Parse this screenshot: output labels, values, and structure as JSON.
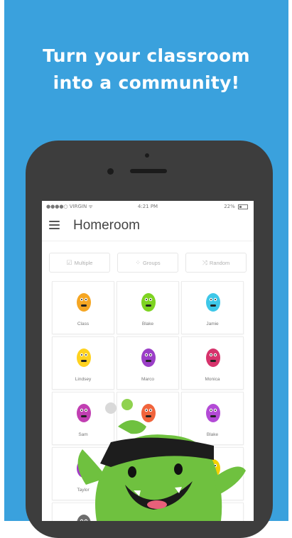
{
  "promo": {
    "headline_line1": "Turn your classroom",
    "headline_line2": "into a community!",
    "background_color": "#3aa1dd"
  },
  "statusbar": {
    "carrier": "●●●●○ VIRGIN ᯤ",
    "time": "4:21 PM",
    "battery": "22%"
  },
  "app": {
    "title": "Homeroom",
    "menu_icon": "hamburger-menu-icon"
  },
  "toolbar": {
    "multiple_label": "Multiple",
    "multiple_icon": "multi-select-icon",
    "groups_label": "Groups",
    "groups_icon": "groups-icon",
    "random_label": "Random",
    "random_icon": "shuffle-icon"
  },
  "students": [
    {
      "name": "Class",
      "color": "#f5a623"
    },
    {
      "name": "Blake",
      "color": "#7ed321"
    },
    {
      "name": "Jamie",
      "color": "#3ec7e8"
    },
    {
      "name": "Lindsey",
      "color": "#ffd21f"
    },
    {
      "name": "Marco",
      "color": "#9b3fc7"
    },
    {
      "name": "Monica",
      "color": "#d6336c"
    },
    {
      "name": "Sam",
      "color": "#c13fb2"
    },
    {
      "name": "",
      "color": "#f0643c"
    },
    {
      "name": "Blake",
      "color": "#b34bd6"
    },
    {
      "name": "Taylor",
      "color": "#a23bc6"
    },
    {
      "name": "",
      "color": "#ffffff"
    },
    {
      "name": "",
      "color": "#f5d000"
    },
    {
      "name": "",
      "color": "#6d6d6d"
    },
    {
      "name": "",
      "color": "#ffffff"
    },
    {
      "name": "",
      "color": "#ffffff"
    }
  ],
  "mascot": {
    "name": "green-monster-mascot",
    "color": "#6fc13f"
  }
}
